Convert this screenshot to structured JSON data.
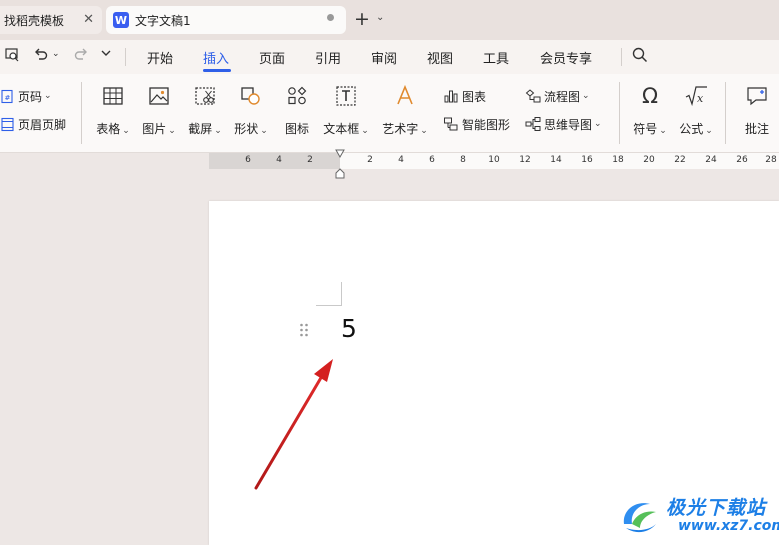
{
  "tabs": [
    {
      "label": "找稻壳模板",
      "close": "✕"
    },
    {
      "label": "文字文稿1",
      "app_icon": "W"
    }
  ],
  "new_tab": "+",
  "new_tab_menu": "⌄",
  "menu": {
    "items": [
      "开始",
      "插入",
      "页面",
      "引用",
      "审阅",
      "视图",
      "工具",
      "会员专享"
    ],
    "active": "插入"
  },
  "ribbon": {
    "page_number": "页码",
    "header_footer": "页眉页脚",
    "table": "表格",
    "picture": "图片",
    "screenshot": "截屏",
    "shape": "形状",
    "icon": "图标",
    "textbox": "文本框",
    "wordart": "艺术字",
    "chart": "图表",
    "smart_shape": "智能图形",
    "flowchart": "流程图",
    "mindmap": "思维导图",
    "symbol": "符号",
    "formula": "公式",
    "comment": "批注"
  },
  "ruler": {
    "left_ticks": [
      "6",
      "4",
      "2"
    ],
    "right_ticks": [
      "2",
      "4",
      "6",
      "8",
      "10",
      "12",
      "14",
      "16",
      "18",
      "20",
      "22",
      "24",
      "26",
      "28"
    ]
  },
  "document": {
    "text": "5"
  },
  "watermark": {
    "name": "极光下载站",
    "url": "www.xz7.com"
  },
  "colors": {
    "accent": "#2f5fe8",
    "arrow": "#d42020",
    "watermark": "#1d7fe6"
  }
}
